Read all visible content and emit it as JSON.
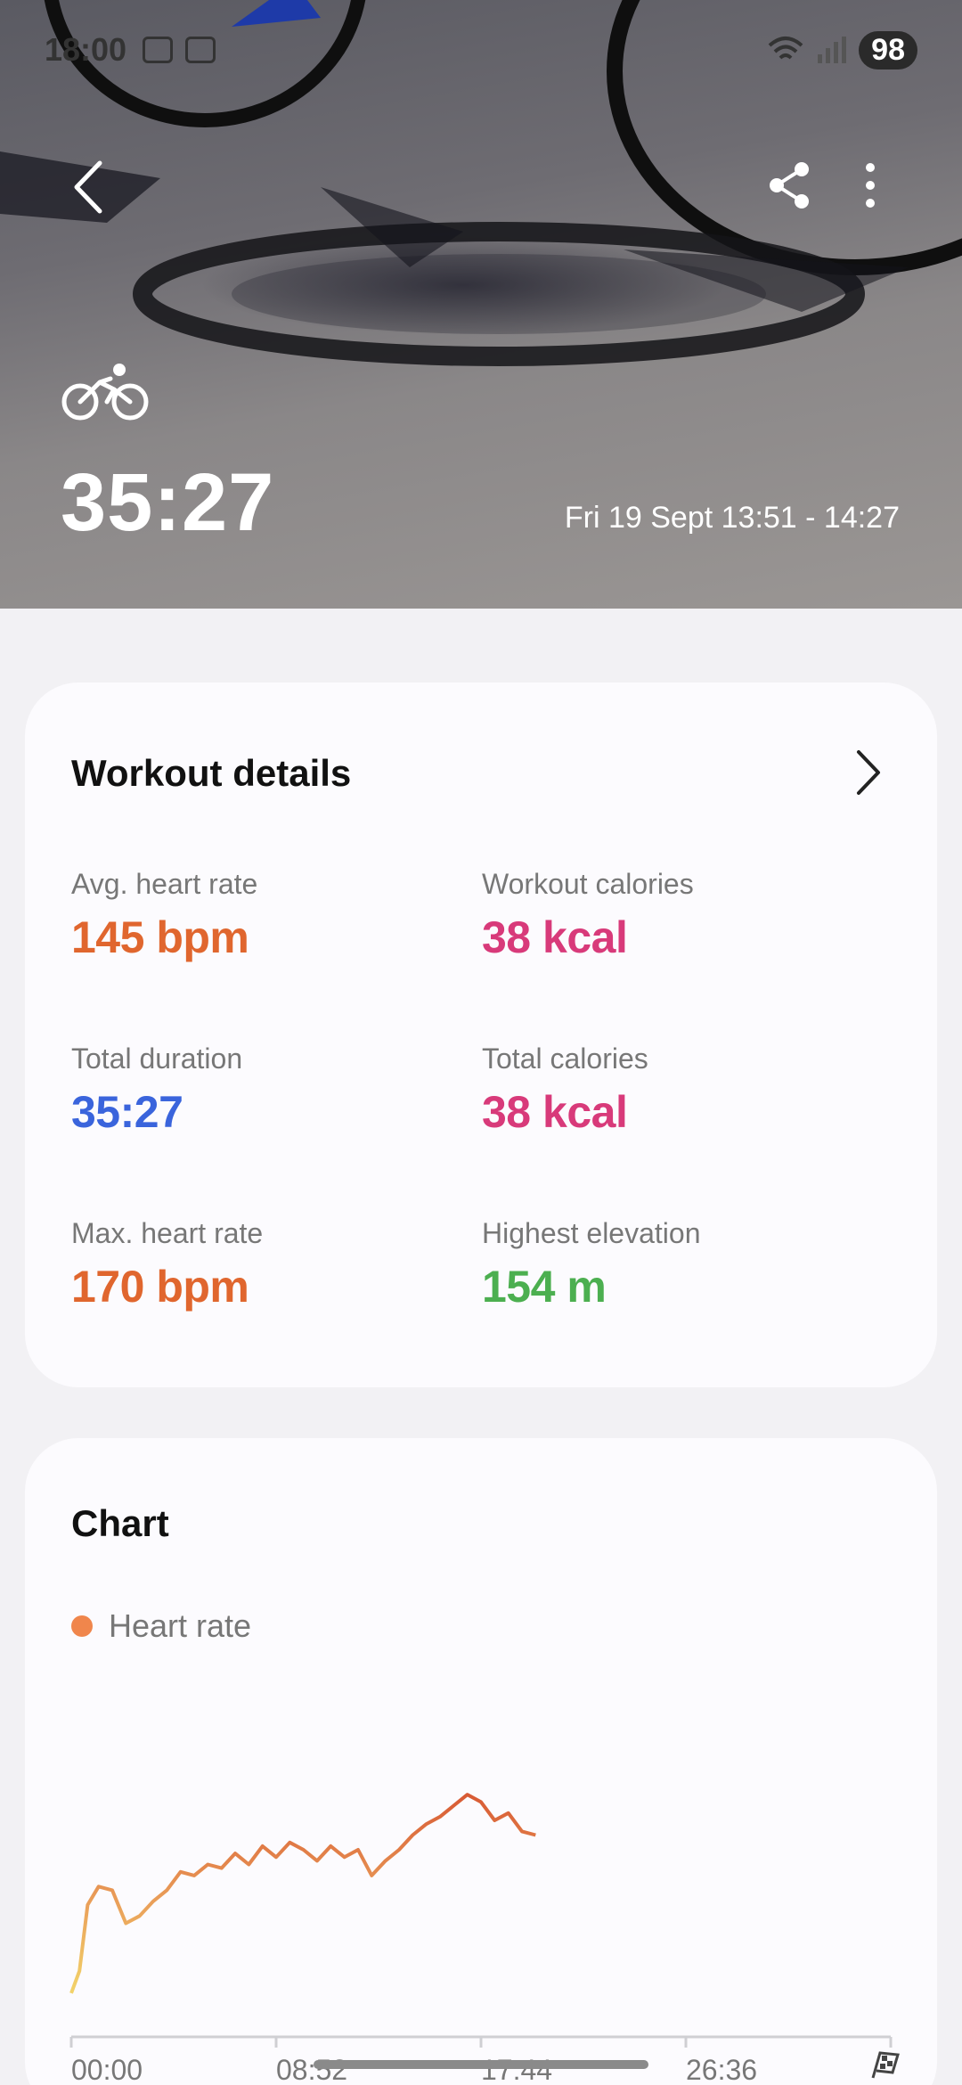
{
  "status_bar": {
    "time": "18:00",
    "battery": "98"
  },
  "hero": {
    "duration": "35:27",
    "date_range": "Fri 19 Sept 13:51 - 14:27"
  },
  "details": {
    "title": "Workout details",
    "metrics": [
      {
        "label": "Avg. heart rate",
        "value": "145",
        "unit": "bpm",
        "color": "#e0662e"
      },
      {
        "label": "Workout calories",
        "value": "38",
        "unit": "kcal",
        "color": "#d83a7a"
      },
      {
        "label": "Total duration",
        "value": "35:27",
        "unit": "",
        "color": "#3a64dc"
      },
      {
        "label": "Total calories",
        "value": "38",
        "unit": "kcal",
        "color": "#d83a7a"
      },
      {
        "label": "Max. heart rate",
        "value": "170",
        "unit": "bpm",
        "color": "#e0662e"
      },
      {
        "label": "Highest elevation",
        "value": "154",
        "unit": "m",
        "color": "#4caf50"
      }
    ]
  },
  "chart_section": {
    "title": "Chart",
    "legend": "Heart rate"
  },
  "chart_data": {
    "type": "line",
    "categories": [
      "00:00",
      "08:52",
      "17:44",
      "26:36"
    ],
    "series": [
      {
        "name": "Heart rate",
        "color": "#e0662e",
        "x": [
          0,
          0.3,
          0.6,
          1.0,
          1.5,
          2.0,
          2.5,
          3.0,
          3.5,
          4.0,
          4.5,
          5.0,
          5.5,
          6.0,
          6.5,
          7.0,
          7.5,
          8.0,
          8.5,
          9.0,
          9.5,
          10.0,
          10.5,
          11.0,
          11.5,
          12.0,
          12.5,
          13.0,
          13.5,
          14.0,
          14.5,
          15.0,
          15.5,
          16.0,
          16.5,
          17.0
        ],
        "y": [
          109,
          115,
          133,
          138,
          137,
          128,
          130,
          134,
          137,
          142,
          141,
          144,
          143,
          147,
          144,
          149,
          146,
          150,
          148,
          145,
          149,
          146,
          148,
          141,
          145,
          148,
          152,
          155,
          157,
          160,
          163,
          161,
          156,
          158,
          153,
          152
        ]
      }
    ],
    "x_range": [
      0,
      30
    ],
    "y_range": [
      100,
      180
    ],
    "x_ticks": [
      "00:00",
      "08:52",
      "17:44",
      "26:36"
    ]
  },
  "icons": [
    "back-arrow",
    "share",
    "more-vert",
    "bicycle",
    "chevron-right",
    "finish-flag"
  ]
}
